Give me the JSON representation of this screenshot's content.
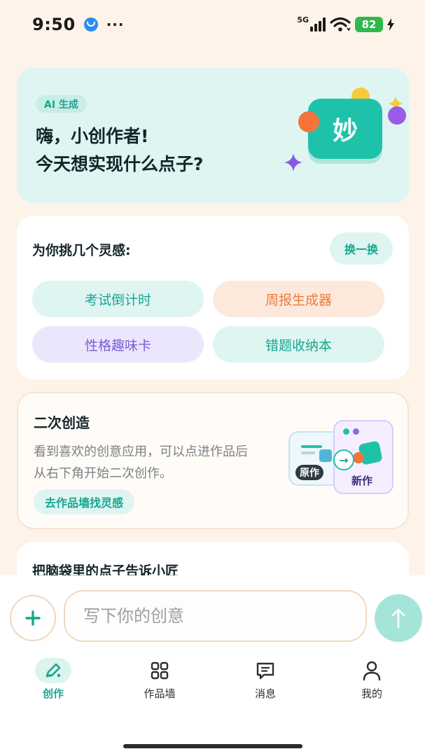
{
  "status_bar": {
    "time": "9:50",
    "more": "···",
    "network": "5G",
    "battery": "82",
    "colors": {
      "battery": "#2fb84c",
      "app_dot": "#2b8cf0"
    }
  },
  "hero": {
    "badge": "AI 生成",
    "title_line1": "嗨，小创作者!",
    "title_line2": "今天想实现什么点子?",
    "tile_char": "妙"
  },
  "inspiration": {
    "title": "为你挑几个灵感:",
    "swap_label": "换一换",
    "chips": [
      {
        "label": "考试倒计时",
        "bg": "#def5f2",
        "fg": "#18a58f"
      },
      {
        "label": "周报生成器",
        "bg": "#fde9dc",
        "fg": "#ee7a3a"
      },
      {
        "label": "性格趣味卡",
        "bg": "#ece6fd",
        "fg": "#7b5bd6"
      },
      {
        "label": "错题收纳本",
        "bg": "#def5f2",
        "fg": "#18a58f"
      }
    ]
  },
  "remix": {
    "title": "二次创造",
    "desc_line1": "看到喜欢的创意应用，可以点进作品后",
    "desc_line2": "从右下角开始二次创作。",
    "link_label": "去作品墙找灵感",
    "art": {
      "original_label": "原作",
      "new_label": "新作"
    }
  },
  "tell_card": {
    "title": "把脑袋里的点子告诉小匠"
  },
  "composer": {
    "placeholder": "写下你的创意",
    "value": ""
  },
  "tabs": [
    {
      "label": "创作",
      "icon": "pencil-sparkle-icon",
      "active": true
    },
    {
      "label": "作品墙",
      "icon": "grid-icon",
      "active": false
    },
    {
      "label": "消息",
      "icon": "chat-icon",
      "active": false
    },
    {
      "label": "我的",
      "icon": "person-icon",
      "active": false
    }
  ],
  "colors": {
    "page_bg": "#fdf3e8",
    "accent": "#18a58f",
    "teal_tile": "#1ec2a8",
    "hero_bg": "#def5f2"
  }
}
